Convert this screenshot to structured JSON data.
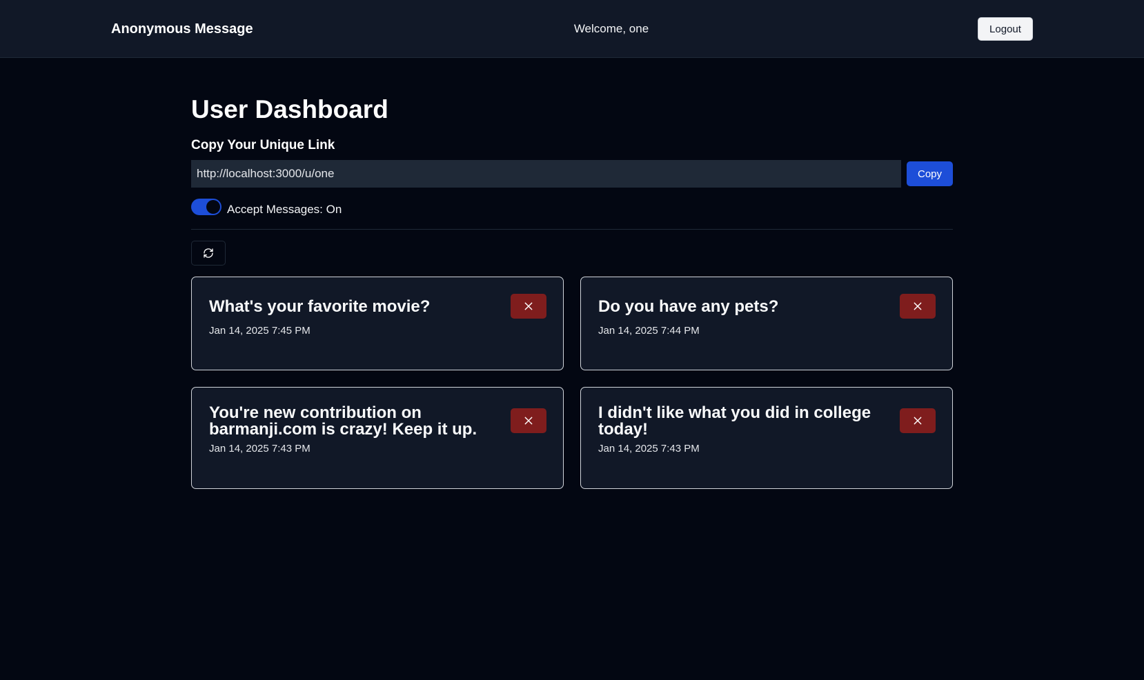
{
  "header": {
    "brand": "Anonymous Message",
    "welcome": "Welcome, one",
    "logout_label": "Logout"
  },
  "dashboard": {
    "title": "User Dashboard",
    "link_section_label": "Copy Your Unique Link",
    "unique_link": "http://localhost:3000/u/one",
    "copy_label": "Copy",
    "accept_messages_label": "Accept Messages: On",
    "accept_messages_on": true
  },
  "messages": [
    {
      "content": "What's your favorite movie?",
      "date": "Jan 14, 2025 7:45 PM"
    },
    {
      "content": "Do you have any pets?",
      "date": "Jan 14, 2025 7:44 PM"
    },
    {
      "content": "You're new contribution on barmanji.com is crazy! Keep it up.",
      "date": "Jan 14, 2025 7:43 PM"
    },
    {
      "content": "I didn't like what you did in college today!",
      "date": "Jan 14, 2025 7:43 PM"
    }
  ],
  "icons": {
    "refresh": "refresh-icon",
    "delete": "close-icon"
  },
  "colors": {
    "background": "#030712",
    "navbar": "#111827",
    "accent": "#1d4ed8",
    "delete": "#7f1d1d"
  }
}
